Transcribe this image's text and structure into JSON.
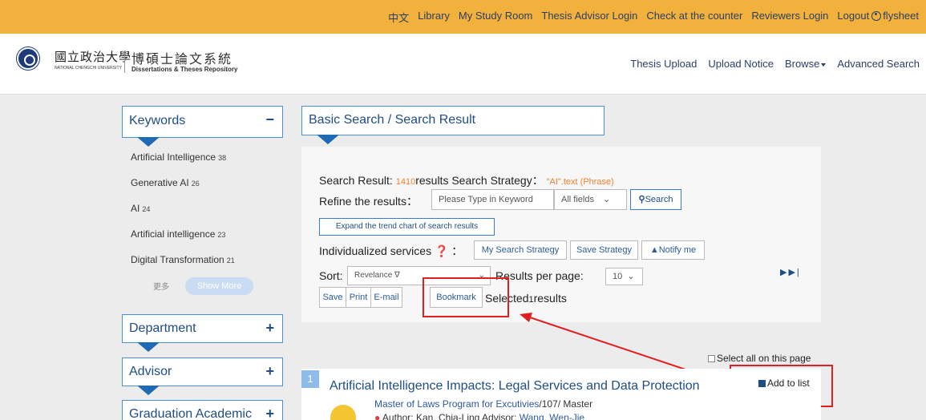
{
  "topbar": {
    "links": [
      "中文",
      "Library",
      "My Study Room",
      "Thesis Advisor Login",
      "Check at the counter",
      "Reviewers Login",
      "Logout",
      "flysheet"
    ],
    "user_icon": "user-circle-icon"
  },
  "header": {
    "university_name": "國立政治大學",
    "university_sub": "NATIONAL CHENGCHI UNIVERSITY",
    "repo_title": "博碩士論文系統",
    "repo_sub": "Dissertations & Theses Repository",
    "nav": [
      "Thesis Upload",
      "Upload Notice",
      "Browse",
      "Advanced Search"
    ]
  },
  "sidebar": {
    "keywords_title": "Keywords",
    "keywords": [
      {
        "label": "Artificial Intelligence",
        "count": "38"
      },
      {
        "label": "Generative AI",
        "count": "26"
      },
      {
        "label": "AI",
        "count": "24"
      },
      {
        "label": "Artificial intelligence",
        "count": "23"
      },
      {
        "label": "Digital Transformation",
        "count": "21"
      }
    ],
    "more_label": "更多",
    "show_more": "Show More",
    "department": "Department",
    "advisor": "Advisor",
    "graduation": "Graduation Academic"
  },
  "search": {
    "breadcrumb": "Basic Search / Search Result",
    "result_prefix": "Search Result:",
    "result_count": "1410",
    "result_mid": "results Search Strategy：",
    "strategy": "\"AI\".text (Phrase)",
    "refine_label": "Refine the results：",
    "keyword_placeholder": "Please Type in Keyword",
    "field_select": "All fields",
    "search_button": "Search",
    "trend_button": "Expand the trend chart of search results",
    "individualized_label": "Individualized services",
    "my_strategy": "My Search Strategy",
    "save_strategy": "Save Strategy",
    "notify": "Notify me",
    "sort_label": "Sort:",
    "sort_value": "Revelance",
    "per_page_label": "Results per page:",
    "per_page_value": "10",
    "actions": [
      "Save",
      "Print",
      "E-mail",
      "Bookmark"
    ],
    "selected_prefix": "Selected",
    "selected_count": "1",
    "selected_suffix": "results"
  },
  "results": {
    "select_all": "Select all on this page",
    "add_to_list": "Add to list",
    "items": [
      {
        "number": "1",
        "title": "Artificial Intelligence Impacts: Legal Services and Data Protection",
        "program": "Master of Laws Program for Excutivies",
        "meta": "/107/ Master",
        "author_label": "Author:",
        "author": "Kan, Chia-Ling",
        "advisor_label": "Advisor:",
        "advisor": "Wang, Wen-Jie"
      }
    ]
  }
}
